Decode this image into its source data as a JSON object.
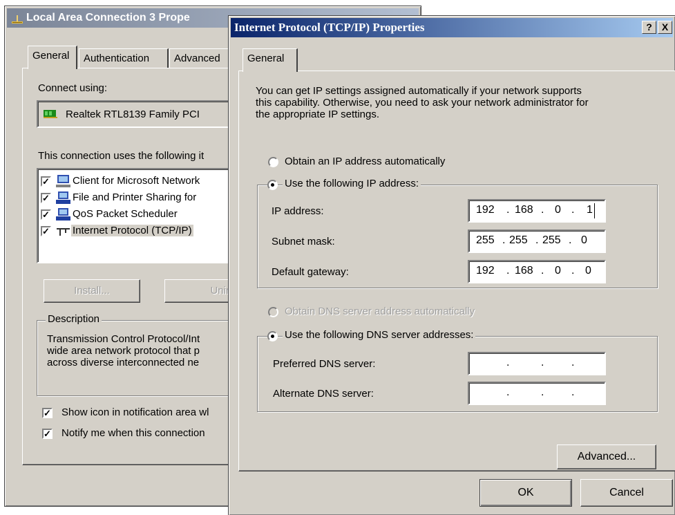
{
  "left_window": {
    "title": "Local Area Connection 3 Prope",
    "tabs": [
      "General",
      "Authentication",
      "Advanced"
    ],
    "connect_using_label": "Connect using:",
    "adapter_name": "Realtek RTL8139 Family PCI",
    "components_label": "This connection uses the following it",
    "components": [
      {
        "label": "Client for Microsoft Network",
        "checked": true,
        "icon": "network-client-icon"
      },
      {
        "label": "File and Printer Sharing for",
        "checked": true,
        "icon": "file-printer-sharing-icon"
      },
      {
        "label": "QoS Packet Scheduler",
        "checked": true,
        "icon": "qos-scheduler-icon"
      },
      {
        "label": "Internet Protocol (TCP/IP)",
        "checked": true,
        "icon": "protocol-icon"
      }
    ],
    "install_label": "Install...",
    "uninstall_label": "Uninst",
    "description_label": "Description",
    "description_lines": [
      "Transmission Control Protocol/Int",
      "wide area network protocol that p",
      "across diverse interconnected ne"
    ],
    "show_icon_label": "Show icon in notification area wl",
    "notify_label": "Notify me when this connection"
  },
  "dialog": {
    "title": "Internet Protocol (TCP/IP) Properties",
    "help_button": "?",
    "close_button": "X",
    "tab": "General",
    "intro_lines": [
      "You can get IP settings assigned automatically if your network supports",
      "this capability. Otherwise, you need to ask your network administrator for",
      "the appropriate IP settings."
    ],
    "obtain_ip_auto": "Obtain an IP address automatically",
    "use_following_ip": "Use the following IP address:",
    "ip_address_label": "IP address:",
    "ip_address": [
      "192",
      "168",
      "0",
      "1"
    ],
    "subnet_mask_label": "Subnet mask:",
    "subnet_mask": [
      "255",
      "255",
      "255",
      "0"
    ],
    "gateway_label": "Default gateway:",
    "gateway": [
      "192",
      "168",
      "0",
      "0"
    ],
    "obtain_dns_auto": "Obtain DNS server address automatically",
    "use_following_dns": "Use the following DNS server addresses:",
    "preferred_dns_label": "Preferred DNS server:",
    "alternate_dns_label": "Alternate DNS server:",
    "advanced_button": "Advanced...",
    "ok_button": "OK",
    "cancel_button": "Cancel"
  },
  "colors": {
    "face": "#d4d0c8",
    "active_title": "#0a246a",
    "inactive_title": "#7b8597",
    "disabled_text": "#a0a0a0"
  }
}
